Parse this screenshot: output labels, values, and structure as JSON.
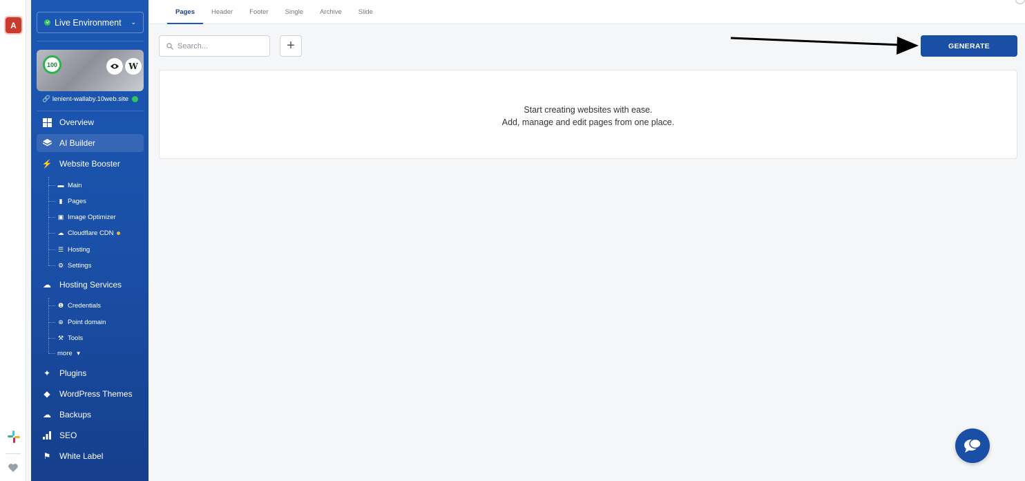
{
  "rail": {
    "avatar_letter": "A"
  },
  "sidebar": {
    "environment": "Live Environment",
    "site": {
      "score": "100",
      "wp_label": "W",
      "url": "lenient-wallaby.10web.site"
    },
    "items": [
      {
        "label": "Overview",
        "icon": "overview-icon"
      },
      {
        "label": "AI Builder",
        "icon": "ai-builder-icon",
        "active": true
      },
      {
        "label": "Website Booster",
        "icon": "bolt-icon"
      },
      {
        "label": "Hosting Services",
        "icon": "cloud-icon"
      },
      {
        "label": "Plugins",
        "icon": "plug-icon"
      },
      {
        "label": "WordPress Themes",
        "icon": "theme-icon"
      },
      {
        "label": "Backups",
        "icon": "backup-icon"
      },
      {
        "label": "SEO",
        "icon": "seo-icon"
      },
      {
        "label": "White Label",
        "icon": "tag-icon"
      }
    ],
    "booster_sub": [
      {
        "label": "Main",
        "icon": "monitor-icon"
      },
      {
        "label": "Pages",
        "icon": "page-icon"
      },
      {
        "label": "Image Optimizer",
        "icon": "image-icon"
      },
      {
        "label": "Cloudflare CDN",
        "icon": "cloudflare-icon"
      },
      {
        "label": "Hosting",
        "icon": "server-icon"
      },
      {
        "label": "Settings",
        "icon": "settings-icon"
      }
    ],
    "hosting_sub": [
      {
        "label": "Credentials",
        "icon": "info-icon"
      },
      {
        "label": "Point domain",
        "icon": "globe-icon"
      },
      {
        "label": "Tools",
        "icon": "tools-icon"
      },
      {
        "label": "more",
        "icon": "chevron-down-icon"
      }
    ]
  },
  "tabs": [
    "Pages",
    "Header",
    "Footer",
    "Single",
    "Archive",
    "Slide"
  ],
  "toolbar": {
    "search_placeholder": "Search...",
    "plus_label": "+",
    "generate_label": "GENERATE"
  },
  "empty_state": {
    "line1": "Start creating websites with ease.",
    "line2": "Add, manage and edit pages from one place."
  },
  "colors": {
    "accent": "#1a4fa6",
    "status_green": "#2ec45f",
    "brand_red": "#c93b2d"
  }
}
